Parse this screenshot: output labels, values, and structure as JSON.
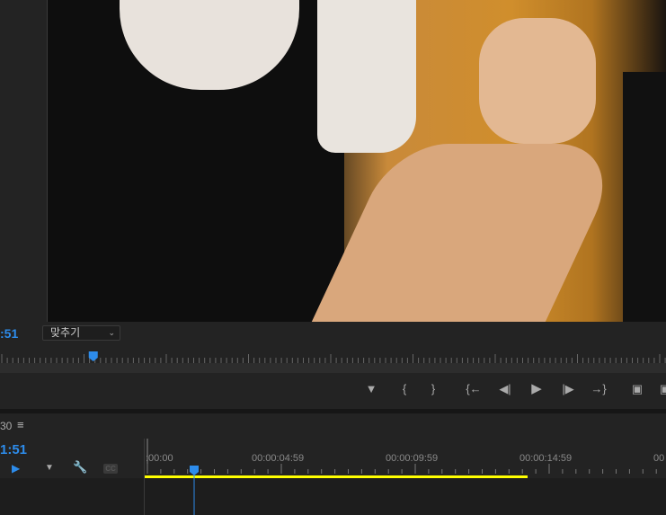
{
  "program_monitor": {
    "timecode": ":51",
    "fit_dropdown": "맞추기",
    "playhead_percent": 14
  },
  "transport": {
    "buttons": [
      "add-marker",
      "mark-in",
      "mark-out",
      "go-to-in",
      "step-back",
      "play",
      "step-forward",
      "go-to-out",
      "lift",
      "extract"
    ]
  },
  "timeline": {
    "sequence_fragment": "30",
    "timecode": "1:51",
    "ruler_labels": [
      ":00:00",
      "00:00:04:59",
      "00:00:09:59",
      "00:00:14:59",
      "00"
    ],
    "work_area_color": "#ffff00",
    "playhead_color": "#2d8ceb"
  }
}
